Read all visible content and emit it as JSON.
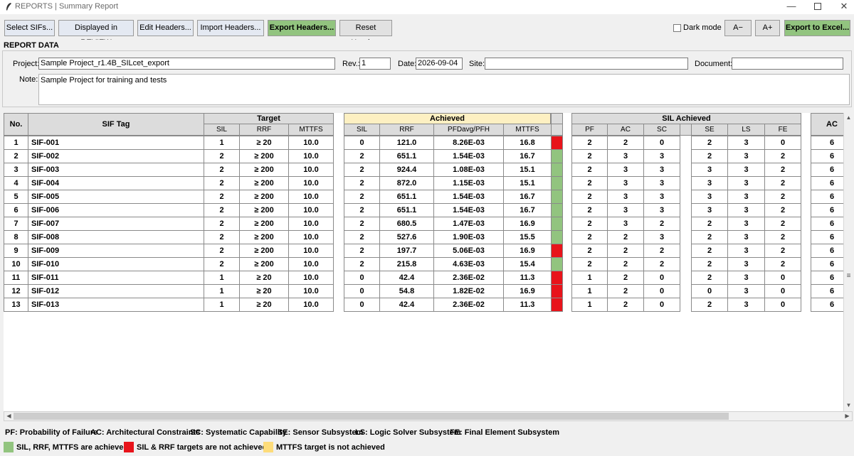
{
  "window": {
    "title": "REPORTS | Summary Report",
    "controls": [
      "—",
      "☐",
      "✕"
    ]
  },
  "toolbar": {
    "select_sifs": "Select SIFs...",
    "displayed_in_review": "Displayed in REVIEW",
    "edit_headers": "Edit Headers...",
    "import_headers": "Import Headers...",
    "export_headers": "Export Headers...",
    "reset_headers": "Reset Headers",
    "dark_mode": "Dark mode",
    "dark_mode_checked": false,
    "font_minus": "A−",
    "font_plus": "A+",
    "export_excel": "Export to Excel..."
  },
  "report_data": {
    "heading": "REPORT DATA",
    "project_label": "Project:",
    "project_value": "Sample Project_r1.4B_SILcet_export",
    "rev_label": "Rev.:",
    "rev_value": "1",
    "date_label": "Date:",
    "date_value": "2026-09-04",
    "site_label": "Site:",
    "site_value": "",
    "document_label": "Document:",
    "document_value": "",
    "note_label": "Note:",
    "note_value": "Sample Project for training and tests"
  },
  "table": {
    "headers": {
      "no": "No.",
      "sif_tag": "SIF Tag",
      "target": "Target",
      "achieved": "Achieved",
      "sil_achieved": "SIL Achieved",
      "ac_partial": "AC"
    },
    "target_cols": [
      "SIL",
      "RRF",
      "MTTFS"
    ],
    "achieved_cols": [
      "SIL",
      "RRF",
      "PFDavg/PFH",
      "MTTFS"
    ],
    "sil_cols_a": [
      "PF",
      "AC",
      "SC"
    ],
    "sil_cols_b": [
      "SE",
      "LS",
      "FE"
    ],
    "rows": [
      {
        "no": "1",
        "tag": "SIF-001",
        "t_sil": "1",
        "t_rrf": "≥ 20",
        "t_mttfs": "10.0",
        "a_sil": "0",
        "a_rrf": "121.0",
        "a_pfd": "8.26E-03",
        "a_mttfs": "16.8",
        "status": "red",
        "pf": "2",
        "ac": "2",
        "sc": "0",
        "se": "2",
        "ls": "3",
        "fe": "0",
        "ac2": "6"
      },
      {
        "no": "2",
        "tag": "SIF-002",
        "t_sil": "2",
        "t_rrf": "≥ 200",
        "t_mttfs": "10.0",
        "a_sil": "2",
        "a_rrf": "651.1",
        "a_pfd": "1.54E-03",
        "a_mttfs": "16.7",
        "status": "green",
        "pf": "2",
        "ac": "3",
        "sc": "3",
        "se": "2",
        "ls": "3",
        "fe": "2",
        "ac2": "6"
      },
      {
        "no": "3",
        "tag": "SIF-003",
        "t_sil": "2",
        "t_rrf": "≥ 200",
        "t_mttfs": "10.0",
        "a_sil": "2",
        "a_rrf": "924.4",
        "a_pfd": "1.08E-03",
        "a_mttfs": "15.1",
        "status": "green",
        "pf": "2",
        "ac": "3",
        "sc": "3",
        "se": "3",
        "ls": "3",
        "fe": "2",
        "ac2": "6"
      },
      {
        "no": "4",
        "tag": "SIF-004",
        "t_sil": "2",
        "t_rrf": "≥ 200",
        "t_mttfs": "10.0",
        "a_sil": "2",
        "a_rrf": "872.0",
        "a_pfd": "1.15E-03",
        "a_mttfs": "15.1",
        "status": "green",
        "pf": "2",
        "ac": "3",
        "sc": "3",
        "se": "3",
        "ls": "3",
        "fe": "2",
        "ac2": "6"
      },
      {
        "no": "5",
        "tag": "SIF-005",
        "t_sil": "2",
        "t_rrf": "≥ 200",
        "t_mttfs": "10.0",
        "a_sil": "2",
        "a_rrf": "651.1",
        "a_pfd": "1.54E-03",
        "a_mttfs": "16.7",
        "status": "green",
        "pf": "2",
        "ac": "3",
        "sc": "3",
        "se": "3",
        "ls": "3",
        "fe": "2",
        "ac2": "6"
      },
      {
        "no": "6",
        "tag": "SIF-006",
        "t_sil": "2",
        "t_rrf": "≥ 200",
        "t_mttfs": "10.0",
        "a_sil": "2",
        "a_rrf": "651.1",
        "a_pfd": "1.54E-03",
        "a_mttfs": "16.7",
        "status": "green",
        "pf": "2",
        "ac": "3",
        "sc": "3",
        "se": "3",
        "ls": "3",
        "fe": "2",
        "ac2": "6"
      },
      {
        "no": "7",
        "tag": "SIF-007",
        "t_sil": "2",
        "t_rrf": "≥ 200",
        "t_mttfs": "10.0",
        "a_sil": "2",
        "a_rrf": "680.5",
        "a_pfd": "1.47E-03",
        "a_mttfs": "16.9",
        "status": "green",
        "pf": "2",
        "ac": "3",
        "sc": "2",
        "se": "2",
        "ls": "3",
        "fe": "2",
        "ac2": "6"
      },
      {
        "no": "8",
        "tag": "SIF-008",
        "t_sil": "2",
        "t_rrf": "≥ 200",
        "t_mttfs": "10.0",
        "a_sil": "2",
        "a_rrf": "527.6",
        "a_pfd": "1.90E-03",
        "a_mttfs": "15.5",
        "status": "green",
        "pf": "2",
        "ac": "2",
        "sc": "3",
        "se": "2",
        "ls": "3",
        "fe": "2",
        "ac2": "6"
      },
      {
        "no": "9",
        "tag": "SIF-009",
        "t_sil": "2",
        "t_rrf": "≥ 200",
        "t_mttfs": "10.0",
        "a_sil": "2",
        "a_rrf": "197.7",
        "a_pfd": "5.06E-03",
        "a_mttfs": "16.9",
        "status": "red",
        "pf": "2",
        "ac": "2",
        "sc": "2",
        "se": "2",
        "ls": "3",
        "fe": "2",
        "ac2": "6"
      },
      {
        "no": "10",
        "tag": "SIF-010",
        "t_sil": "2",
        "t_rrf": "≥ 200",
        "t_mttfs": "10.0",
        "a_sil": "2",
        "a_rrf": "215.8",
        "a_pfd": "4.63E-03",
        "a_mttfs": "15.4",
        "status": "green",
        "pf": "2",
        "ac": "2",
        "sc": "2",
        "se": "2",
        "ls": "3",
        "fe": "2",
        "ac2": "6"
      },
      {
        "no": "11",
        "tag": "SIF-011",
        "t_sil": "1",
        "t_rrf": "≥ 20",
        "t_mttfs": "10.0",
        "a_sil": "0",
        "a_rrf": "42.4",
        "a_pfd": "2.36E-02",
        "a_mttfs": "11.3",
        "status": "red",
        "pf": "1",
        "ac": "2",
        "sc": "0",
        "se": "2",
        "ls": "3",
        "fe": "0",
        "ac2": "6"
      },
      {
        "no": "12",
        "tag": "SIF-012",
        "t_sil": "1",
        "t_rrf": "≥ 20",
        "t_mttfs": "10.0",
        "a_sil": "0",
        "a_rrf": "54.8",
        "a_pfd": "1.82E-02",
        "a_mttfs": "16.9",
        "status": "red",
        "pf": "1",
        "ac": "2",
        "sc": "0",
        "se": "0",
        "ls": "3",
        "fe": "0",
        "ac2": "6"
      },
      {
        "no": "13",
        "tag": "SIF-013",
        "t_sil": "1",
        "t_rrf": "≥ 20",
        "t_mttfs": "10.0",
        "a_sil": "0",
        "a_rrf": "42.4",
        "a_pfd": "2.36E-02",
        "a_mttfs": "11.3",
        "status": "red",
        "pf": "1",
        "ac": "2",
        "sc": "0",
        "se": "2",
        "ls": "3",
        "fe": "0",
        "ac2": "6"
      }
    ]
  },
  "legend": {
    "abbreviations": [
      "PF: Probability of Failure",
      "AC: Architectural Constraints",
      "SC: Systematic Capability",
      "SE: Sensor Subsystem",
      "LS: Logic Solver Subsystem",
      "FE: Final Element Subsystem"
    ],
    "status": [
      {
        "label": "SIL, RRF, MTTFS are achieved",
        "color": "#92c47f"
      },
      {
        "label": "SIL & RRF targets are not achieved",
        "color": "#e8141b"
      },
      {
        "label": "MTTFS target is not achieved",
        "color": "#fddc7a"
      }
    ]
  },
  "colors": {
    "status_green": "#92c47f",
    "status_red": "#e8141b",
    "header_gray": "#dcdcdc",
    "achieved_header": "#fdf0c2",
    "button_blue": "#e4e9f2",
    "button_green": "#92c47f"
  },
  "icons": {
    "app": "feather-icon",
    "minimize": "minimize-icon",
    "maximize": "maximize-icon",
    "close": "close-icon"
  }
}
